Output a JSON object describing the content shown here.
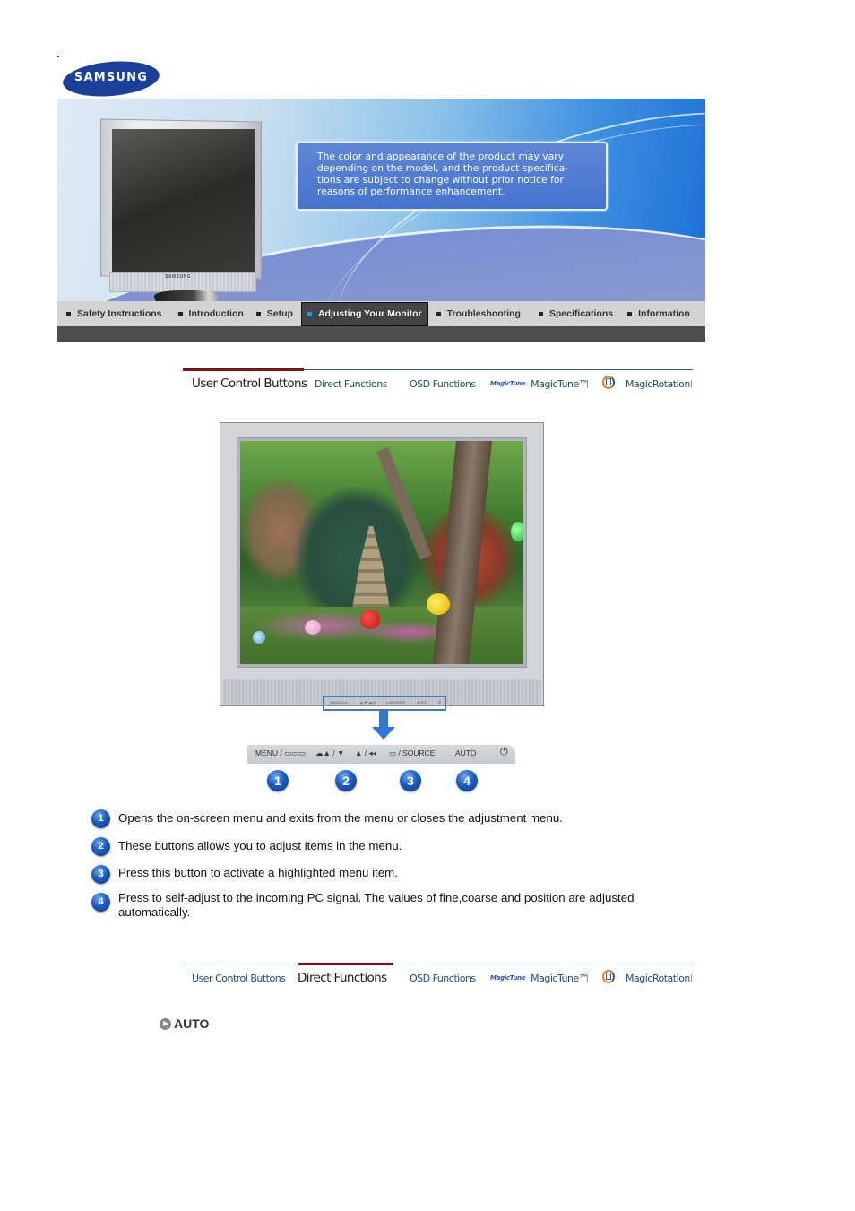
{
  "brand": {
    "logo_text": "SAMSUNG",
    "logo_color": "#1b3f9a"
  },
  "banner": {
    "notice_text": "The color and appearance of the product may vary depending on the model, and the product specifications are subject to change without prior notice for reasons of performance enhancement.",
    "notice_lines": [
      "The color and appearance of the product may vary",
      "depending on the model, and the product specifica-",
      "tions are subject to change without prior notice for",
      "reasons of performance enhancement."
    ],
    "monitor_brand": "SAMSUNG"
  },
  "nav": {
    "items": [
      {
        "label": "Safety Instructions",
        "active": false
      },
      {
        "label": "Introduction",
        "active": false
      },
      {
        "label": "Setup",
        "active": false
      },
      {
        "label": "Adjusting Your Monitor",
        "active": true
      },
      {
        "label": "Troubleshooting",
        "active": false
      },
      {
        "label": "Specifications",
        "active": false
      },
      {
        "label": "Information",
        "active": false
      }
    ],
    "active_marker_color": "#1e9df0"
  },
  "tabs_top": {
    "items": [
      {
        "label": "User Control Buttons",
        "active": true
      },
      {
        "label": "Direct Functions",
        "active": false
      },
      {
        "label": "OSD Functions",
        "active": false
      },
      {
        "label": "MagicTune™",
        "logo": "MagicTune",
        "active": false
      },
      {
        "label": "MagicRotation",
        "icon": "magicrotation-icon",
        "active": false
      }
    ],
    "active_bar_color": "#8b0d1a"
  },
  "tabs_bottom": {
    "items": [
      {
        "label": "User Control Buttons",
        "active": false
      },
      {
        "label": "Direct Functions",
        "active": true
      },
      {
        "label": "OSD Functions",
        "active": false
      },
      {
        "label": "MagicTune™",
        "logo": "MagicTune",
        "active": false
      },
      {
        "label": "MagicRotation",
        "icon": "magicrotation-icon",
        "active": false
      }
    ]
  },
  "control_panel": {
    "buttons": [
      {
        "label": "MENU / ▭▭▭",
        "number": "1"
      },
      {
        "label": "☁▲ / ▼",
        "number": "2"
      },
      {
        "label": "▲ / ◂◂",
        "number": "3"
      },
      {
        "label": "▭ / SOURCE",
        "number": "3"
      },
      {
        "label": "AUTO",
        "number": "4"
      },
      {
        "label": "⏻",
        "number": ""
      }
    ],
    "mini_labels": [
      "MENU/▭▭",
      "▲/▼ ▲/◂",
      "▭/SOURCE",
      "AUTO",
      "⏻"
    ],
    "badges": [
      "1",
      "2",
      "3",
      "4"
    ]
  },
  "descriptions": [
    {
      "number": "1",
      "text": "Opens the on-screen menu and exits from the menu or closes the adjustment menu."
    },
    {
      "number": "2",
      "text": "These buttons allows you to adjust items in the menu."
    },
    {
      "number": "3",
      "text": "Press this button to activate a highlighted menu item."
    },
    {
      "number": "4",
      "text": "Press to self-adjust to the incoming PC signal. The values of fine,coarse and position are adjusted automatically."
    }
  ],
  "section": {
    "title": "AUTO"
  }
}
